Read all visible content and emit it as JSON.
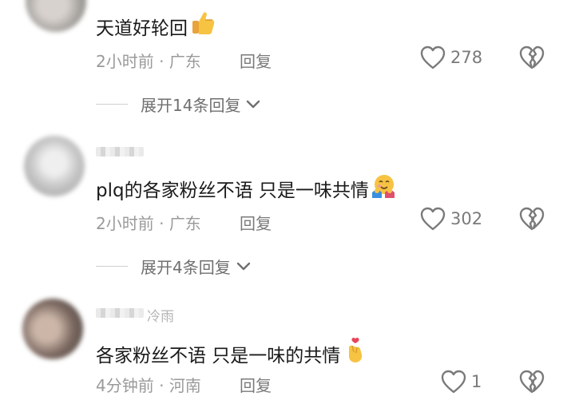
{
  "comments": [
    {
      "text": "天道好轮回",
      "emoji_icon": "thumbs-up-icon",
      "time": "2小时前",
      "location": "广东",
      "reply_label": "回复",
      "likes": "278",
      "expand_label": "展开14条回复"
    },
    {
      "text": "plq的各家粉丝不语 只是一味共情",
      "emoji_icon": "hug-face-icon",
      "time": "2小时前",
      "location": "广东",
      "reply_label": "回复",
      "likes": "302",
      "expand_label": "展开4条回复"
    },
    {
      "username_tail": "冷雨",
      "text": "各家粉丝不语 只是一味的共情",
      "emoji_icon": "finger-heart-icon",
      "time": "4分钟前",
      "location": "河南",
      "reply_label": "回复",
      "likes": "1"
    }
  ],
  "separator": " · "
}
